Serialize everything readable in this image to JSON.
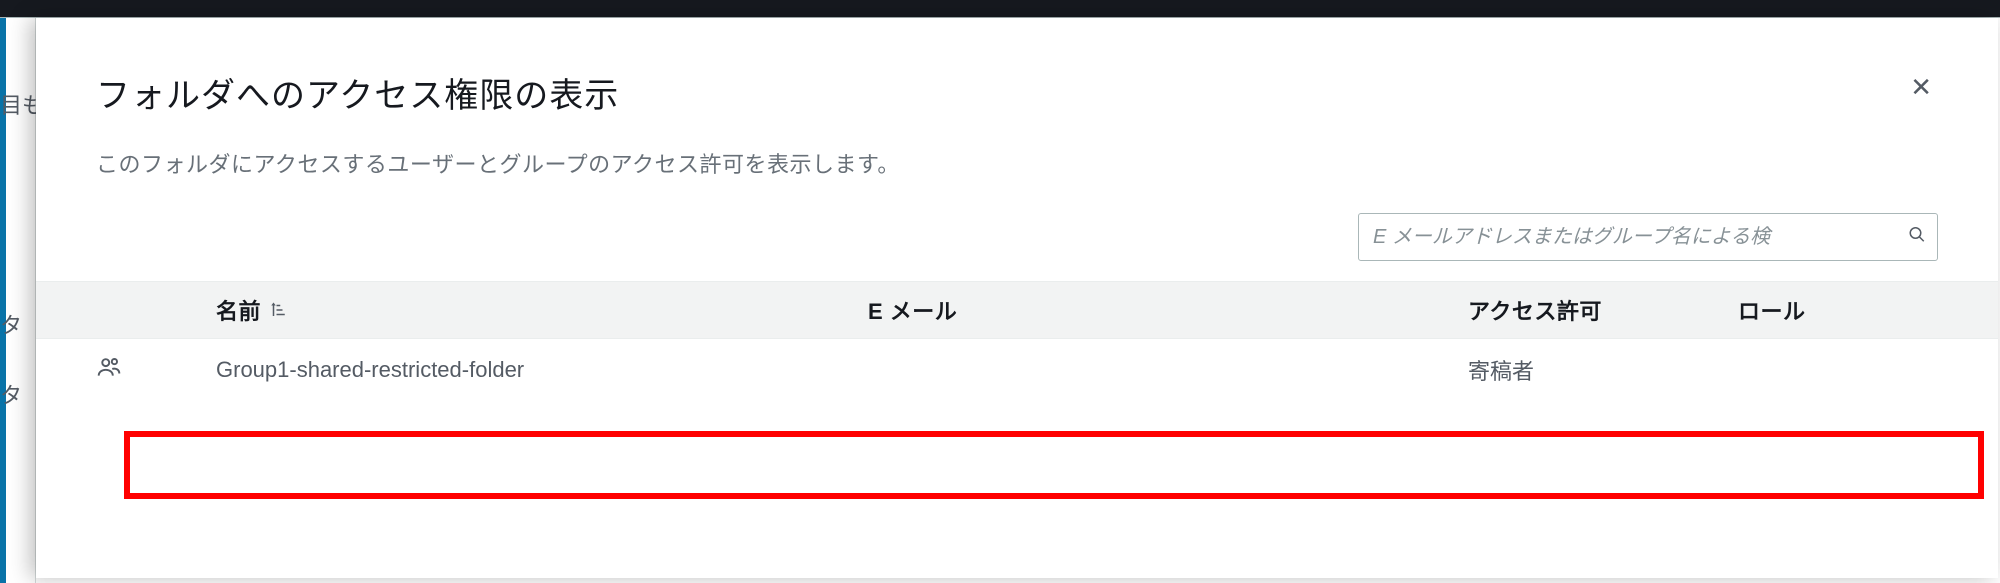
{
  "modal": {
    "title": "フォルダへのアクセス権限の表示",
    "subtitle": "このフォルダにアクセスするユーザーとグループのアクセス許可を表示します。",
    "search_placeholder": "E メールアドレスまたはグループ名による検",
    "close_label": "✕"
  },
  "table": {
    "columns": {
      "name": "名前",
      "email": "E メール",
      "access": "アクセス許可",
      "role": "ロール"
    },
    "rows": [
      {
        "icon": "group-icon",
        "name": "Group1-shared-restricted-folder",
        "email": "",
        "access": "寄稿者",
        "role": ""
      }
    ]
  },
  "background": {
    "frag1": "目も",
    "frag2": "タ",
    "frag3": "タ"
  }
}
